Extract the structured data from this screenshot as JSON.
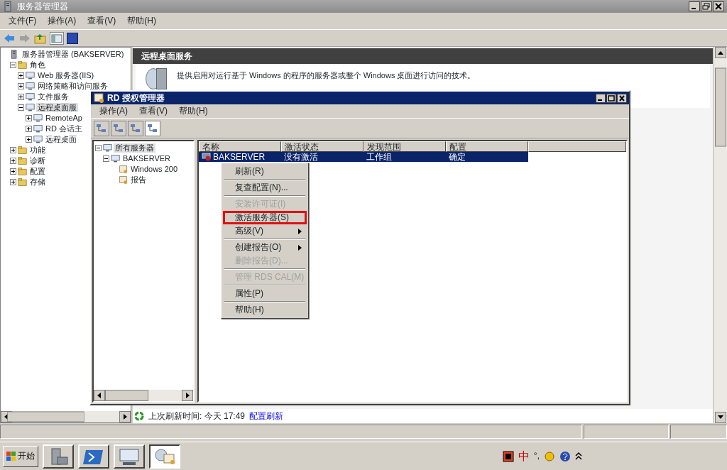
{
  "window": {
    "title": "服务器管理器"
  },
  "menu": [
    "文件(F)",
    "操作(A)",
    "查看(V)",
    "帮助(H)"
  ],
  "tree": [
    {
      "label": "服务器管理器 (BAKSERVER)",
      "selected": false,
      "children": [
        {
          "label": "角色",
          "expanded": true,
          "selected": false,
          "children": [
            {
              "label": "Web 服务器(IIS)",
              "expanded": false,
              "selected": false
            },
            {
              "label": "网络策略和访问服务",
              "expanded": false,
              "selected": false
            },
            {
              "label": "文件服务",
              "expanded": false,
              "selected": false
            },
            {
              "label": "远程桌面服",
              "expanded": true,
              "selected": true,
              "children": [
                {
                  "label": "RemoteAp",
                  "expanded": false,
                  "selected": false
                },
                {
                  "label": "RD 会话主",
                  "expanded": false,
                  "selected": false
                },
                {
                  "label": "远程桌面",
                  "expanded": false,
                  "selected": false
                }
              ]
            }
          ]
        },
        {
          "label": "功能",
          "expanded": false,
          "selected": false
        },
        {
          "label": "诊断",
          "expanded": false,
          "selected": false
        },
        {
          "label": "配置",
          "expanded": false,
          "selected": false
        },
        {
          "label": "存储",
          "expanded": false,
          "selected": false
        }
      ]
    }
  ],
  "panel": {
    "title": "远程桌面服务",
    "description": "提供启用对运行基于 Windows 的程序的服务器或整个 Windows 桌面进行访问的技术。"
  },
  "refresh": {
    "label": "上次刷新时间: 今天 17:49",
    "link": "配置刷新"
  },
  "dialog": {
    "title": "RD 授权管理器",
    "menu": [
      "操作(A)",
      "查看(V)",
      "帮助(H)"
    ],
    "tree": [
      {
        "label": "所有服务器",
        "expanded": true,
        "selected": true,
        "children": [
          {
            "label": "BAKSERVER",
            "expanded": true,
            "selected": false,
            "children": [
              {
                "label": "Windows 200",
                "selected": false
              },
              {
                "label": "报告",
                "selected": false
              }
            ]
          }
        ]
      }
    ],
    "columns": [
      "名称",
      "激活状态",
      "发现范围",
      "配置"
    ],
    "rows": [
      {
        "cells": [
          "BAKSERVER",
          "没有激活",
          "工作组",
          "确定"
        ],
        "selected": true
      }
    ]
  },
  "context_menu": [
    {
      "kind": "item",
      "label": "刷新(R)",
      "disabled": false,
      "submenu": false,
      "highlighted": false
    },
    {
      "kind": "separator"
    },
    {
      "kind": "item",
      "label": "复查配置(N)...",
      "disabled": false,
      "submenu": false,
      "highlighted": false
    },
    {
      "kind": "separator"
    },
    {
      "kind": "item",
      "label": "安装许可证(I)",
      "disabled": true,
      "submenu": false,
      "highlighted": false
    },
    {
      "kind": "item",
      "label": "激活服务器(S)",
      "disabled": false,
      "submenu": false,
      "highlighted": true
    },
    {
      "kind": "item",
      "label": "高级(V)",
      "disabled": false,
      "submenu": true,
      "highlighted": false
    },
    {
      "kind": "separator"
    },
    {
      "kind": "item",
      "label": "创建报告(O)",
      "disabled": false,
      "submenu": true,
      "highlighted": false
    },
    {
      "kind": "item",
      "label": "删除报告(D)...",
      "disabled": true,
      "submenu": false,
      "highlighted": false
    },
    {
      "kind": "separator"
    },
    {
      "kind": "item",
      "label": "管理 RDS CAL(M)",
      "disabled": true,
      "submenu": false,
      "highlighted": false
    },
    {
      "kind": "separator"
    },
    {
      "kind": "item",
      "label": "属性(P)",
      "disabled": false,
      "submenu": false,
      "highlighted": false
    },
    {
      "kind": "separator"
    },
    {
      "kind": "item",
      "label": "帮助(H)",
      "disabled": false,
      "submenu": false,
      "highlighted": false
    }
  ],
  "taskbar": {
    "start": "开始",
    "apps": [
      {
        "selected": false
      },
      {
        "selected": false
      },
      {
        "selected": false
      },
      {
        "selected": true
      }
    ],
    "ime": "中",
    "punct": "°,"
  }
}
